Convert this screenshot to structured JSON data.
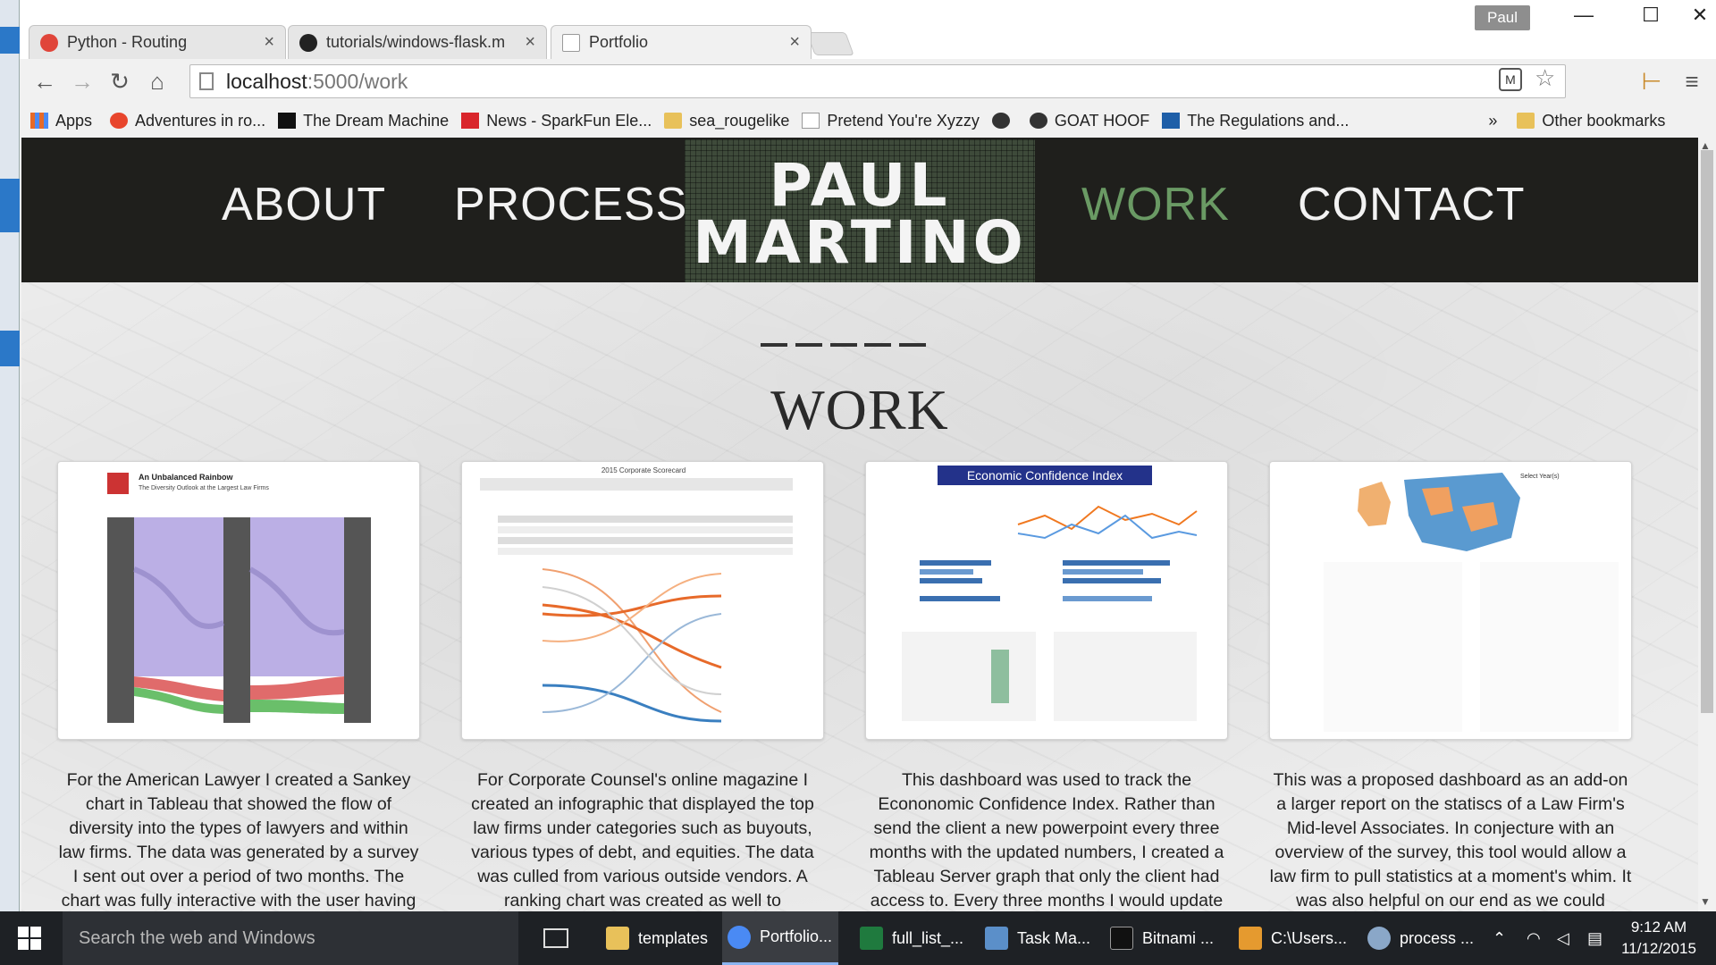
{
  "browser": {
    "tabs": [
      {
        "title": "Python - Routing",
        "close": "×",
        "icon_color": "#e0453a"
      },
      {
        "title": "tutorials/windows-flask.m",
        "close": "×",
        "icon_color": "#222"
      },
      {
        "title": "Portfolio",
        "close": "×",
        "icon_color": "#ddd"
      }
    ],
    "user": "Paul",
    "window_controls": {
      "minimize": "—",
      "maximize": "☐",
      "close": "✕"
    },
    "nav": {
      "back": "←",
      "forward": "→",
      "reload": "↻",
      "home": "⌂"
    },
    "url": {
      "host": "localhost",
      "path": ":5000/work"
    },
    "bookmarks": [
      {
        "label": "Apps",
        "icon_color": "#e66a28"
      },
      {
        "label": "Adventures in ro...",
        "icon_color": "#e8452c"
      },
      {
        "label": "The Dream Machine",
        "icon_color": "#111"
      },
      {
        "label": "News - SparkFun Ele...",
        "icon_color": "#d9262c"
      },
      {
        "label": "sea_rougelike",
        "icon_color": "#e8c15a"
      },
      {
        "label": "Pretend You're Xyzzy",
        "icon_color": "#ddd"
      },
      {
        "label": "",
        "icon_color": "#333"
      },
      {
        "label": "GOAT HOOF",
        "icon_color": "#333"
      },
      {
        "label": "The Regulations and...",
        "icon_color": "#1f5fa8"
      }
    ],
    "overflow": "»",
    "other_bookmarks": "Other bookmarks"
  },
  "site": {
    "nav": {
      "about": "ABOUT",
      "process": "PROCESS",
      "work": "WORK",
      "contact": "CONTACT"
    },
    "logo": {
      "line1": "PAUL",
      "line2": "MARTINO"
    },
    "heading": "WORK",
    "cards": [
      {
        "title": "An Unbalanced Rainbow",
        "subtitle": "The Diversity Outlook at the Largest Law Firms",
        "description": "For the American Lawyer I created a Sankey chart in Tableau that showed the flow of diversity into the types of lawyers and within law firms. The data was generated by a survey I sent out over a period of two months. The chart was fully interactive with the user having"
      },
      {
        "title": "2015 Corporate Scorecard",
        "description": "For Corporate Counsel's online magazine I created an infographic that displayed the top law firms under categories such as buyouts, various types of debt, and equities. The data was culled from various outside vendors. A ranking chart was created as well to"
      },
      {
        "title": "Economic Confidence Index",
        "description": "This dashboard was used to track the Econonomic Confidence Index. Rather than send the client a new powerpoint every three months with the updated numbers, I created a Tableau Server graph that only the client had access to. Every three months I would update"
      },
      {
        "title": "Select Year(s)",
        "description": "This was a proposed dashboard as an add-on a larger report on the statiscs of a Law Firm's Mid-level Associates. In conjecture with an overview of the survey, this tool would allow a law firm to pull statistics at a moment's whim. It was also helpful on our end as we could"
      }
    ]
  },
  "taskbar": {
    "search_placeholder": "Search the web and Windows",
    "items": [
      {
        "label": "templates",
        "icon_color": "#e8c15a"
      },
      {
        "label": "Portfolio...",
        "icon_color": "#4a8af4"
      },
      {
        "label": "full_list_...",
        "icon_color": "#1f7a3e"
      },
      {
        "label": "Task Ma...",
        "icon_color": "#5b8fc9"
      },
      {
        "label": "Bitnami ...",
        "icon_color": "#111"
      },
      {
        "label": "C:\\Users...",
        "icon_color": "#e59a2f"
      },
      {
        "label": "process ...",
        "icon_color": "#8aa7c8"
      }
    ],
    "time": "9:12 AM",
    "date": "11/12/2015"
  },
  "colors": {
    "nav_bg": "#1f1f1c",
    "nav_active": "#6a9a64",
    "logo_bg": "#3e4a3a"
  }
}
